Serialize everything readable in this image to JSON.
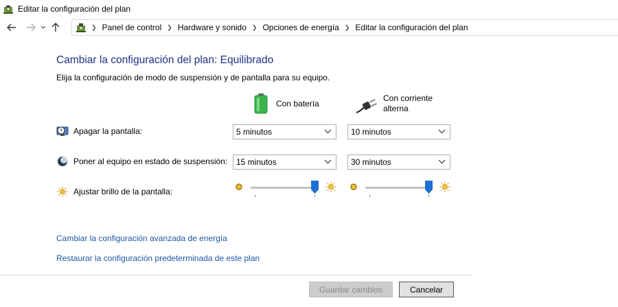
{
  "window": {
    "title": "Editar la configuración del plan"
  },
  "nav": {
    "breadcrumbs": [
      "Panel de control",
      "Hardware y sonido",
      "Opciones de energía",
      "Editar la configuración del plan"
    ]
  },
  "page": {
    "heading": "Cambiar la configuración del plan: Equilibrado",
    "subheading": "Elija la configuración de modo de suspensión y de pantalla para su equipo."
  },
  "columns": {
    "battery": "Con batería",
    "ac_line1": "Con corriente",
    "ac_line2": "alterna"
  },
  "settings": {
    "display_off": {
      "label": "Apagar la pantalla:",
      "battery": "5 minutos",
      "ac": "10 minutos"
    },
    "sleep": {
      "label": "Poner al equipo en estado de suspensión:",
      "battery": "15 minutos",
      "ac": "30 minutos"
    },
    "brightness": {
      "label": "Ajustar brillo de la pantalla:",
      "battery_level": 1.0,
      "ac_level": 1.0
    }
  },
  "links": {
    "advanced": "Cambiar la configuración avanzada de energía",
    "restore": "Restaurar la configuración predeterminada de este plan"
  },
  "buttons": {
    "save": "Guardar cambios",
    "cancel": "Cancelar"
  },
  "colors": {
    "heading": "#1e3287",
    "link": "#1e56a8",
    "slider_thumb": "#1e6fd2",
    "battery_green": "#3bb54a"
  }
}
